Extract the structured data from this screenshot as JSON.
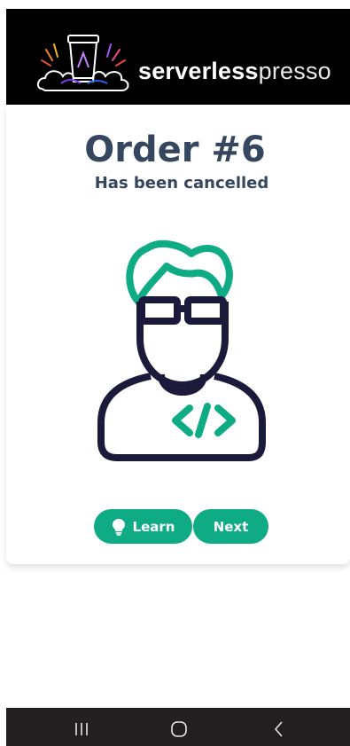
{
  "header": {
    "brand_bold": "serverless",
    "brand_light": "presso",
    "logo_icon": "serverlesspresso-coffee-cup-logo"
  },
  "order": {
    "title": "Order #6",
    "status": "Has been cancelled"
  },
  "illustration": {
    "icon": "developer-avatar-icon"
  },
  "actions": {
    "learn_label": "Learn",
    "learn_icon": "lightbulb-icon",
    "next_label": "Next"
  },
  "system_nav": {
    "recents_icon": "recents-icon",
    "home_icon": "home-icon",
    "back_icon": "back-icon"
  },
  "colors": {
    "accent": "#0eab85",
    "title": "#34475e",
    "outline": "#1c1a3b",
    "header_bg": "#000000",
    "navbar_bg": "#231f20"
  }
}
